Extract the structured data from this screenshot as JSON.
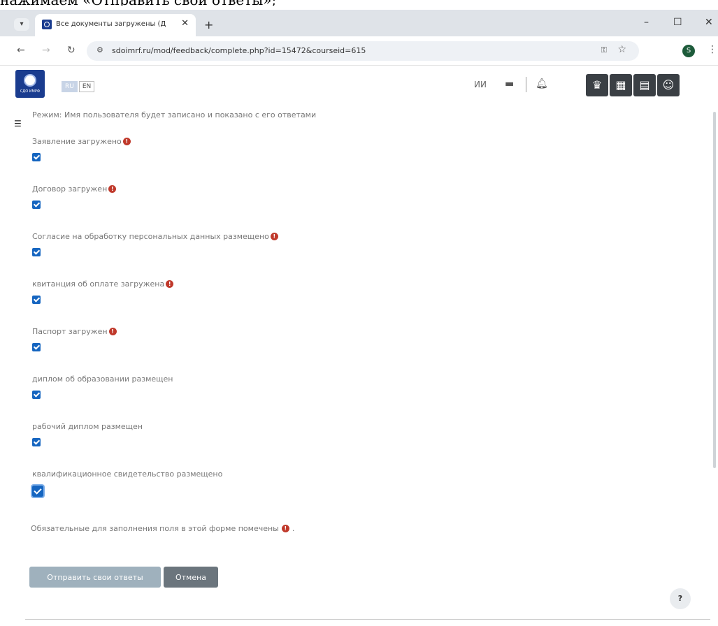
{
  "caption": "нажимаем «Отправить свои ответы»;",
  "browser": {
    "tab_title": "Все документы загружены (Д",
    "tab_close": "✕",
    "new_tab": "+",
    "window": {
      "minimize": "–",
      "maximize": "☐",
      "close": "✕"
    },
    "url": "sdoimrf.ru/mod/feedback/complete.php?id=15472&courseid=615",
    "profile_initial": "S"
  },
  "header": {
    "logo_text": "СДО ИМРФ",
    "lang_ru": "RU",
    "lang_en": "EN",
    "user_initials": "ИИ"
  },
  "form": {
    "mode_text": "Режим: Имя пользователя будет записано и показано с его ответами",
    "required_icon": "!",
    "questions": [
      {
        "label": "Заявление загружено",
        "required": true,
        "checked": true
      },
      {
        "label": "Договор загружен",
        "required": true,
        "checked": true
      },
      {
        "label": "Согласие на обработку персональных данных размещено",
        "required": true,
        "checked": true
      },
      {
        "label": "квитанция об оплате загружена",
        "required": true,
        "checked": true
      },
      {
        "label": "Паспорт загружен",
        "required": true,
        "checked": true
      },
      {
        "label": "диплом об образовании размещен",
        "required": false,
        "checked": true
      },
      {
        "label": "рабочий диплом размещен",
        "required": false,
        "checked": true
      },
      {
        "label": "квалификационное свидетельство размещено",
        "required": false,
        "checked": true
      }
    ],
    "required_note": "Обязательные для заполнения поля в этой форме помечены",
    "required_note_end": ".",
    "submit_label": "Отправить свои ответы",
    "cancel_label": "Отмена"
  },
  "help_label": "?"
}
